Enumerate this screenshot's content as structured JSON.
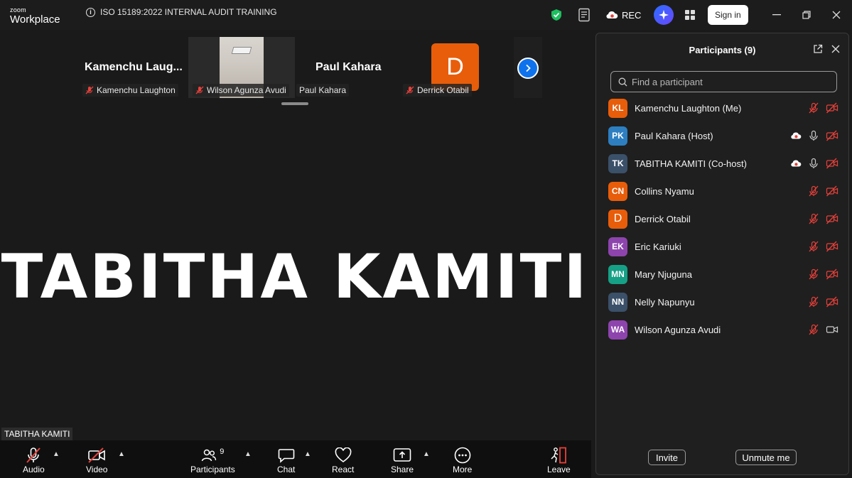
{
  "app": {
    "logo_line1": "zoom",
    "logo_line2": "Workplace",
    "meeting_title": "ISO 15189:2022 INTERNAL AUDIT TRAINING",
    "rec_label": "REC",
    "signin_label": "Sign in"
  },
  "thumbnails": [
    {
      "big_name": "Kamenchu  Laug...",
      "label": "Kamenchu Laughton",
      "muted": true
    },
    {
      "big_name": "",
      "label": "Wilson Agunza Avudi",
      "muted": true
    },
    {
      "big_name": "Paul Kahara",
      "label": "Paul Kahara",
      "muted": false
    },
    {
      "avatar_letter": "D",
      "label": "Derrick Otabil",
      "muted": true
    }
  ],
  "speaker": {
    "big_name": "TABITHA KAMITI",
    "label": "TABITHA KAMITI"
  },
  "toolbar": {
    "audio": "Audio",
    "video": "Video",
    "participants": "Participants",
    "participants_count": "9",
    "chat": "Chat",
    "react": "React",
    "share": "Share",
    "more": "More",
    "leave": "Leave"
  },
  "panel": {
    "title": "Participants (9)",
    "search_placeholder": "Find a participant",
    "invite": "Invite",
    "unmute_me": "Unmute me",
    "participants": [
      {
        "initials": "KL",
        "name": "Kamenchu Laughton (Me)",
        "color": "#e85d0a",
        "cloud": false,
        "mic": "muted",
        "video": "off"
      },
      {
        "initials": "PK",
        "name": "Paul Kahara (Host)",
        "color": "#2d7fc1",
        "cloud": true,
        "mic": "on",
        "video": "off"
      },
      {
        "initials": "TK",
        "name": "TABITHA KAMITI (Co-host)",
        "color": "#3b5069",
        "cloud": true,
        "mic": "on",
        "video": "off"
      },
      {
        "initials": "CN",
        "name": "Collins Nyamu",
        "color": "#e85d0a",
        "cloud": false,
        "mic": "muted",
        "video": "off"
      },
      {
        "initials": "D",
        "name": "Derrick Otabil",
        "color": "#e85d0a",
        "cloud": false,
        "mic": "muted",
        "video": "off"
      },
      {
        "initials": "EK",
        "name": "Eric Kariuki",
        "color": "#8e44ad",
        "cloud": false,
        "mic": "muted",
        "video": "off"
      },
      {
        "initials": "MN",
        "name": "Mary Njuguna",
        "color": "#16a085",
        "cloud": false,
        "mic": "muted",
        "video": "off"
      },
      {
        "initials": "NN",
        "name": "Nelly Napunyu",
        "color": "#3b5069",
        "cloud": false,
        "mic": "muted",
        "video": "off"
      },
      {
        "initials": "WA",
        "name": "Wilson Agunza Avudi",
        "color": "#8e44ad",
        "cloud": false,
        "mic": "muted",
        "video": "on"
      }
    ]
  },
  "colors": {
    "accent_blue": "#0e72ed",
    "muted_red": "#e8403a",
    "shield_green": "#1dbf5f"
  }
}
